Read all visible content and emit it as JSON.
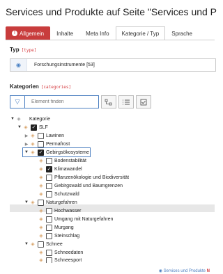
{
  "page": {
    "title": "Services und Produkte auf Seite \"Services und P"
  },
  "tabs": [
    {
      "label": "Allgemein",
      "state": "error"
    },
    {
      "label": "Inhalte",
      "state": "normal"
    },
    {
      "label": "Meta Info",
      "state": "normal"
    },
    {
      "label": "Kategorie / Typ",
      "state": "active"
    },
    {
      "label": "Sprache",
      "state": "normal"
    }
  ],
  "type_field": {
    "label": "Typ",
    "key": "[type]",
    "value": "Forschungsinstrumente [53]"
  },
  "categories": {
    "label": "Kategorien",
    "key": "[categories]",
    "search_placeholder": "Element finden",
    "tree": [
      {
        "label": "Kategorie",
        "checkbox": false
      },
      {
        "label": "SLF",
        "checked": true
      },
      {
        "label": "Lawinen",
        "checked": false
      },
      {
        "label": "Permafrost",
        "checked": false
      },
      {
        "label": "Gebirgsökosysteme",
        "checked": true
      },
      {
        "label": "Bodenstabilität",
        "checked": false
      },
      {
        "label": "Klimawandel",
        "checked": true
      },
      {
        "label": "Pflanzenökologie und Biodiversität",
        "checked": false
      },
      {
        "label": "Gebirgswald und Baumgrenzen",
        "checked": false
      },
      {
        "label": "Schutzwald",
        "checked": false
      },
      {
        "label": "Naturgefahren",
        "checked": false
      },
      {
        "label": "Hochwasser",
        "checked": false
      },
      {
        "label": "Umgang mit Naturgefahren",
        "checked": false
      },
      {
        "label": "Murgang",
        "checked": false
      },
      {
        "label": "Steinschlag",
        "checked": false
      },
      {
        "label": "Schnee",
        "checked": false
      },
      {
        "label": "Schneedaten",
        "checked": false
      },
      {
        "label": "Schneesport",
        "checked": false
      }
    ]
  },
  "footer": {
    "text": "Services und Produkte",
    "suffix": "N"
  },
  "icons": {
    "expanded": "triangle-down-icon",
    "collapsed": "triangle-right-icon",
    "category": "tag-icon",
    "filter": "filter-icon",
    "type": "tag-icon"
  },
  "colors": {
    "accent": "#4a7ec0",
    "error": "#c83c3c",
    "tag": "#d9a46a"
  }
}
